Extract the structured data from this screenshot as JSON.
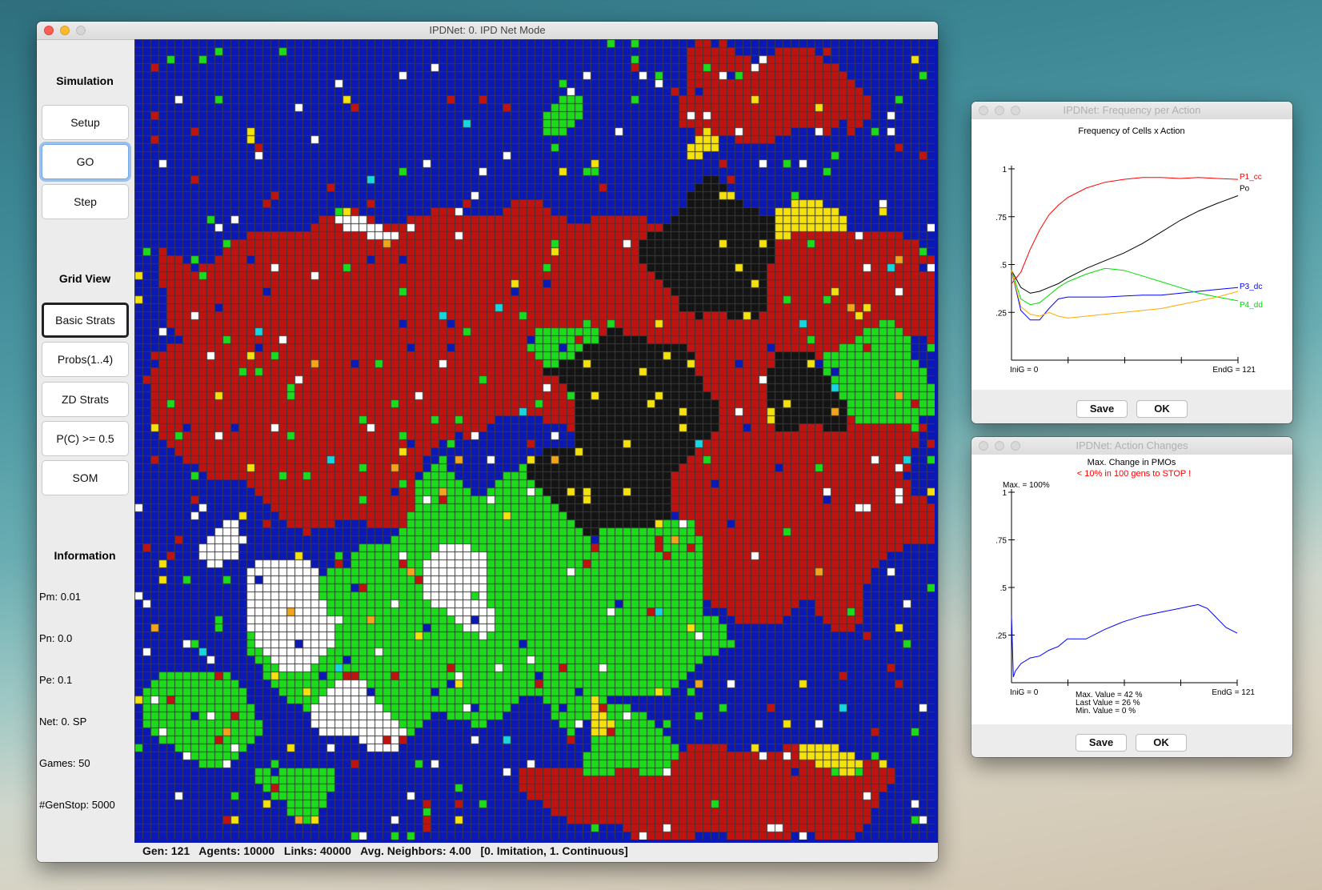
{
  "main_window": {
    "title": "IPDNet:   0. IPD Net Mode",
    "sidebar": {
      "simulation_title": "Simulation",
      "setup_label": "Setup",
      "go_label": "GO",
      "step_label": "Step",
      "gridview_title": "Grid View",
      "view_buttons": [
        "Basic Strats",
        "Probs(1..4)",
        "ZD Strats",
        "P(C) >= 0.5",
        "SOM"
      ],
      "information_title": "Information",
      "info": [
        "Pm: 0.01",
        "Pn: 0.0",
        "Pe: 0.1",
        "Net: 0. SP",
        "Games: 50",
        "#GenStop: 5000"
      ]
    },
    "status_bar": "Gen: 121   Agents: 10000   Links: 40000   Avg. Neighbors: 4.00   [0. Imitation, 1. Continuous]"
  },
  "grid": {
    "rows": 100,
    "cols": 100,
    "colors": {
      "blue": "#0a18b8",
      "red": "#c2120f",
      "green": "#1bdc1b",
      "black": "#141414",
      "white": "#ffffff",
      "yellow": "#f5e10c",
      "cyan": "#18d6e0",
      "orange": "#f2a41b",
      "grid_line": "#3a3a3a"
    }
  },
  "freq_window": {
    "title": "IPDNet: Frequency per Action",
    "chart_title": "Frequency of Cells x Action",
    "save_label": "Save",
    "ok_label": "OK"
  },
  "changes_window": {
    "title": "IPDNet: Action Changes",
    "chart_title": "Max. Change in PMOs",
    "stop_note": "< 10% in 100 gens to STOP !",
    "max_label": "Max. = 100%",
    "stats": [
      "Max. Value = 42  %",
      "Last Value = 26  %",
      "Min. Value = 0  %"
    ],
    "save_label": "Save",
    "ok_label": "OK"
  },
  "chart_data": [
    {
      "type": "line",
      "title": "Frequency of Cells x Action",
      "x": [
        0,
        5,
        10,
        15,
        20,
        25,
        30,
        40,
        50,
        60,
        70,
        80,
        90,
        100,
        110,
        121
      ],
      "x_tick_labels": [
        "IniG = 0",
        "EndG = 121"
      ],
      "y_tick_labels": [
        "1",
        ".75",
        ".5",
        ".25"
      ],
      "ylim": [
        0,
        1
      ],
      "series": [
        {
          "name": "P1_cc",
          "color": "#ff0000",
          "values": [
            0.4,
            0.46,
            0.58,
            0.68,
            0.76,
            0.81,
            0.85,
            0.9,
            0.93,
            0.945,
            0.955,
            0.955,
            0.95,
            0.955,
            0.95,
            0.945
          ]
        },
        {
          "name": "Po",
          "color": "#000000",
          "values": [
            0.47,
            0.38,
            0.35,
            0.36,
            0.38,
            0.4,
            0.43,
            0.48,
            0.52,
            0.56,
            0.61,
            0.67,
            0.73,
            0.78,
            0.82,
            0.86
          ]
        },
        {
          "name": "P3_dc",
          "color": "#0000ff",
          "values": [
            0.47,
            0.26,
            0.21,
            0.21,
            0.27,
            0.32,
            0.33,
            0.33,
            0.33,
            0.335,
            0.34,
            0.34,
            0.35,
            0.36,
            0.37,
            0.38
          ]
        },
        {
          "name": "P4_dd",
          "color": "#00dd00",
          "values": [
            0.47,
            0.32,
            0.29,
            0.3,
            0.34,
            0.38,
            0.41,
            0.45,
            0.48,
            0.47,
            0.44,
            0.41,
            0.38,
            0.35,
            0.33,
            0.31
          ]
        },
        {
          "name": "",
          "color": "#ffaa00",
          "values": [
            0.47,
            0.28,
            0.24,
            0.23,
            0.25,
            0.23,
            0.22,
            0.23,
            0.24,
            0.25,
            0.26,
            0.27,
            0.29,
            0.31,
            0.33,
            0.36
          ]
        }
      ]
    },
    {
      "type": "line",
      "title": "Max. Change in PMOs",
      "x": [
        0,
        1,
        2,
        5,
        10,
        15,
        20,
        25,
        30,
        40,
        50,
        60,
        70,
        80,
        90,
        95,
        100,
        105,
        110,
        115,
        121
      ],
      "x_tick_labels": [
        "IniG = 0",
        "EndG = 121"
      ],
      "y_tick_labels": [
        "1",
        ".75",
        ".5",
        ".25"
      ],
      "ylim": [
        0,
        1
      ],
      "series": [
        {
          "name": "",
          "color": "#0000ff",
          "values": [
            0.35,
            0.03,
            0.06,
            0.1,
            0.13,
            0.14,
            0.17,
            0.19,
            0.23,
            0.23,
            0.28,
            0.32,
            0.35,
            0.37,
            0.39,
            0.4,
            0.41,
            0.39,
            0.34,
            0.29,
            0.26
          ]
        }
      ]
    }
  ]
}
